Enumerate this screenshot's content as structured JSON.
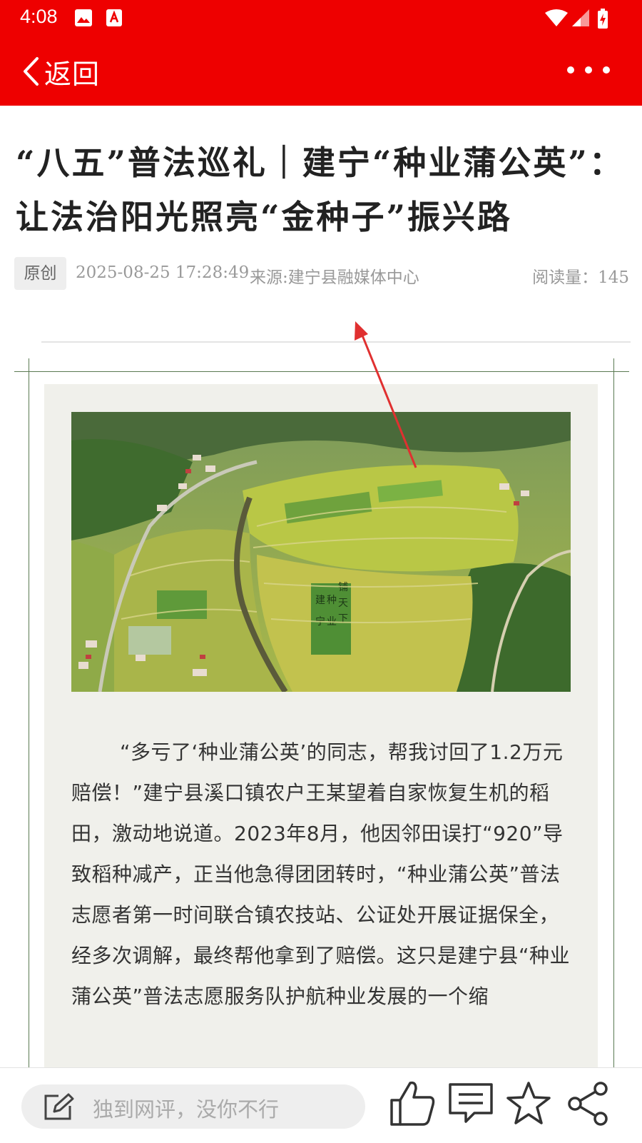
{
  "status_bar": {
    "time": "4:08"
  },
  "nav": {
    "back_label": "返回"
  },
  "article": {
    "title": "“八五”普法巡礼｜建宁“种业蒲公英”：让法治阳光照亮“金种子”振兴路",
    "badge": "原创",
    "date": "2025-08-25 17:28:49",
    "source": "来源:建宁县融媒体中心",
    "read_count": "阅读量：145",
    "photo_banner_chars": [
      "建",
      "宁",
      "种",
      "业",
      "铺",
      "天",
      "下"
    ],
    "body": "“多亏了‘种业蒲公英’的同志，帮我讨回了1.2万元赔偿！”建宁县溪口镇农户王某望着自家恢复生机的稻田，激动地说道。2023年8月，他因邻田误打“920”导致稻种减产，正当他急得团团转时，“种业蒲公英”普法志愿者第一时间联合镇农技站、公证处开展证据保全，经多次调解，最终帮他拿到了赔偿。这只是建宁县“种业蒲公英”普法志愿服务队护航种业发展的一个缩"
  },
  "bottom_bar": {
    "comment_placeholder": "独到网评，没你不行",
    "actions": [
      "like-icon",
      "comment-icon",
      "favorite-icon",
      "share-icon"
    ]
  },
  "colors": {
    "brand_red": "#ee0000",
    "panel": "#f0f0eb",
    "frame": "#5a7a52"
  }
}
